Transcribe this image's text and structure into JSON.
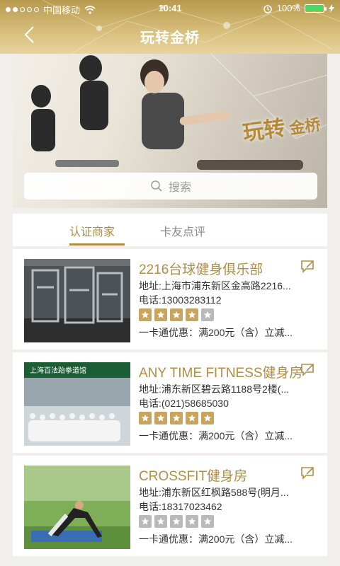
{
  "status": {
    "carrier": "中国移动",
    "time": "10:41",
    "battery": "100%"
  },
  "nav": {
    "title": "玩转金桥"
  },
  "banner": {
    "tagline_main": "玩转",
    "tagline_sub": "金桥",
    "search_placeholder": "搜索"
  },
  "tabs": [
    {
      "label": "认证商家",
      "active": true
    },
    {
      "label": "卡友点评",
      "active": false
    }
  ],
  "merchants": [
    {
      "name": "2216台球健身俱乐部",
      "address": "地址:上海市浦东新区金高路2216...",
      "phone": "电话:13003283112",
      "rating": 4,
      "promo": "一卡通优惠：满200元（含）立减..."
    },
    {
      "name": "ANY TIME FITNESS健身房",
      "address": "地址:浦东新区碧云路1188号2楼(...",
      "phone": "电话:(021)58685030",
      "rating": 5,
      "promo": "一卡通优惠：满200元（含）立减..."
    },
    {
      "name": "CROSSFIT健身房",
      "address": "地址:浦东新区红枫路588号(明月...",
      "phone": "电话:18317023462",
      "rating": 0,
      "promo": "一卡通优惠：满200元（含）立减..."
    }
  ],
  "colors": {
    "accent": "#b08e45",
    "star_on": "#c8a45c",
    "star_off": "#b9b9b9"
  }
}
